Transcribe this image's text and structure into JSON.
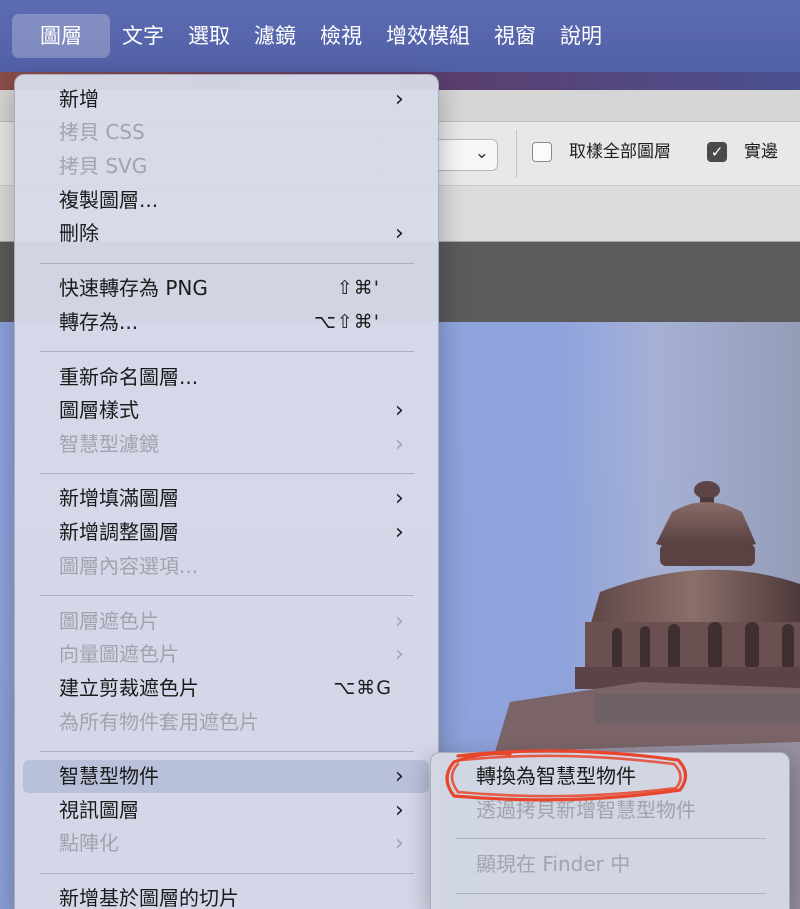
{
  "menubar": {
    "items": [
      "圖層",
      "文字",
      "選取",
      "濾鏡",
      "檢視",
      "增效模組",
      "視窗",
      "說明"
    ],
    "active_index": 0
  },
  "options_bar": {
    "sample_all_layers": {
      "label": "取樣全部圖層",
      "checked": false
    },
    "antialias": {
      "label": "實邊",
      "checked": true
    }
  },
  "layer_menu": {
    "groups": [
      [
        {
          "label": "新增",
          "submenu": true,
          "enabled": true
        },
        {
          "label": "拷貝 CSS",
          "enabled": false
        },
        {
          "label": "拷貝 SVG",
          "enabled": false
        },
        {
          "label": "複製圖層...",
          "enabled": true
        },
        {
          "label": "刪除",
          "submenu": true,
          "enabled": true
        }
      ],
      [
        {
          "label": "快速轉存為 PNG",
          "shortcut": "⇧⌘'",
          "enabled": true
        },
        {
          "label": "轉存為...",
          "shortcut": "⌥⇧⌘'",
          "enabled": true
        }
      ],
      [
        {
          "label": "重新命名圖層...",
          "enabled": true
        },
        {
          "label": "圖層樣式",
          "submenu": true,
          "enabled": true
        },
        {
          "label": "智慧型濾鏡",
          "submenu": true,
          "enabled": false
        }
      ],
      [
        {
          "label": "新增填滿圖層",
          "submenu": true,
          "enabled": true
        },
        {
          "label": "新增調整圖層",
          "submenu": true,
          "enabled": true
        },
        {
          "label": "圖層內容選項...",
          "enabled": false
        }
      ],
      [
        {
          "label": "圖層遮色片",
          "submenu": true,
          "enabled": false
        },
        {
          "label": "向量圖遮色片",
          "submenu": true,
          "enabled": false
        },
        {
          "label": "建立剪裁遮色片",
          "shortcut": "⌥⌘G",
          "enabled": true
        },
        {
          "label": "為所有物件套用遮色片",
          "enabled": false
        }
      ],
      [
        {
          "label": "智慧型物件",
          "submenu": true,
          "enabled": true,
          "selected": true
        },
        {
          "label": "視訊圖層",
          "submenu": true,
          "enabled": true
        },
        {
          "label": "點陣化",
          "submenu": true,
          "enabled": false
        }
      ],
      [
        {
          "label": "新增基於圖層的切片",
          "enabled": true
        }
      ]
    ]
  },
  "smart_object_submenu": {
    "items": [
      {
        "label": "轉換為智慧型物件",
        "enabled": true,
        "highlighted": true
      },
      {
        "label": "透過拷貝新增智慧型物件",
        "enabled": false
      },
      {
        "label": "顯現在 Finder 中",
        "enabled": false
      }
    ]
  },
  "colors": {
    "menubar": "#5866ad",
    "highlight": "#e8452c",
    "selected_item": "#b9c0d9",
    "disabled_text": "#a1a4ae"
  },
  "icons": {
    "submenu_arrow": "chevron-right-icon",
    "select_arrow": "chevron-down-icon",
    "checkbox_checked": "checkmark-icon"
  }
}
